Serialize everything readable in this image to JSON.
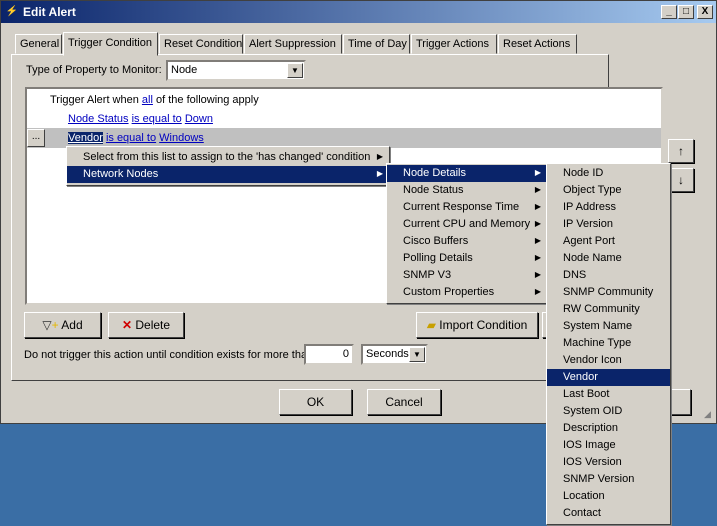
{
  "window": {
    "title": "Edit Alert",
    "min": "_",
    "max": "□",
    "close": "X"
  },
  "tabs": [
    "General",
    "Trigger Condition",
    "Reset Condition",
    "Alert Suppression",
    "Time of Day",
    "Trigger Actions",
    "Reset Actions"
  ],
  "property": {
    "label": "Type of Property to Monitor:",
    "value": "Node"
  },
  "condition": {
    "header_pre": "Trigger Alert when ",
    "header_link": "all",
    "header_post": " of the following apply",
    "row1": {
      "field": "Node Status",
      "op": "is equal to",
      "value": "Down"
    },
    "row2_button": "...",
    "row2": {
      "field": "Vendor",
      "op": "is equal to",
      "value": "Windows"
    }
  },
  "menu1": [
    {
      "label": "Select from this list to assign to the 'has changed' condition",
      "arrow": true
    },
    {
      "label": "Network Nodes",
      "arrow": true,
      "selected": true
    }
  ],
  "menu2": [
    {
      "label": "Node Details",
      "selected": true
    },
    {
      "label": "Node Status"
    },
    {
      "label": "Current Response Time"
    },
    {
      "label": "Current CPU and Memory"
    },
    {
      "label": "Cisco Buffers"
    },
    {
      "label": "Polling Details"
    },
    {
      "label": "SNMP V3"
    },
    {
      "label": "Custom Properties"
    }
  ],
  "menu3": [
    "Node ID",
    "Object Type",
    "IP Address",
    "IP Version",
    "Agent Port",
    "Node Name",
    "DNS",
    "SNMP Community",
    "RW Community",
    "System Name",
    "Machine Type",
    "Vendor Icon",
    "Vendor",
    "Last Boot",
    "System OID",
    "Description",
    "IOS Image",
    "IOS Version",
    "SNMP Version",
    "Location",
    "Contact"
  ],
  "menu3_selected": "Vendor",
  "buttons": {
    "add": "Add",
    "delete": "Delete",
    "import": "Import Condition",
    "ok": "OK",
    "cancel": "Cancel"
  },
  "delay": {
    "label": "Do not trigger this action until condition exists for more than",
    "value": "0",
    "unit": "Seconds"
  },
  "arrows": {
    "up": "↑",
    "down": "↓"
  }
}
